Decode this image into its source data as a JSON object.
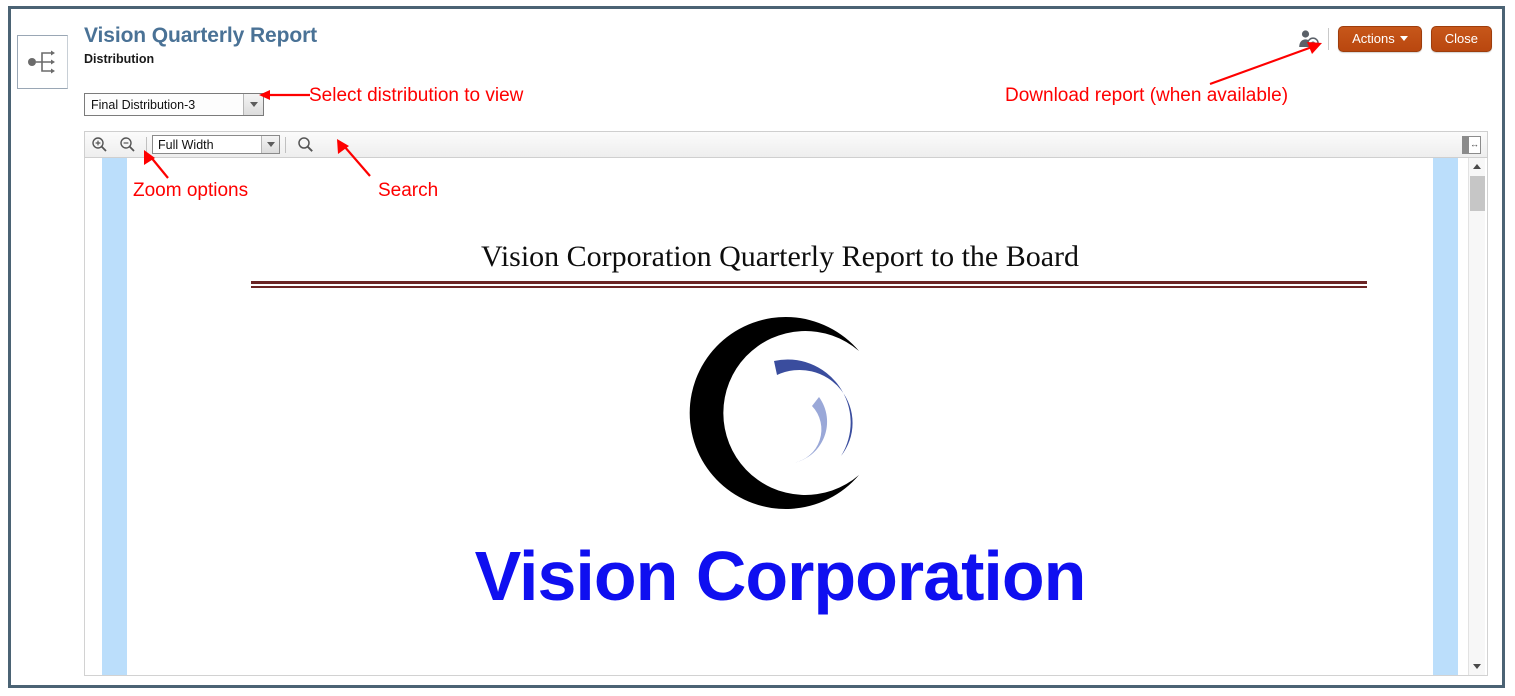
{
  "window": {
    "left_tab_icon": "workflow-branch-icon"
  },
  "header": {
    "title": "Vision Quarterly Report",
    "subtitle": "Distribution",
    "person_icon": "person-question-icon",
    "actions_label": "Actions",
    "close_label": "Close"
  },
  "distribution": {
    "selected": "Final Distribution-3",
    "dropdown_icon": "chevron-down-icon"
  },
  "pdf_toolbar": {
    "zoom_in_icon": "zoom-in-icon",
    "zoom_out_icon": "zoom-out-icon",
    "zoom_level": "Full Width",
    "zoom_dropdown_icon": "chevron-down-icon",
    "search_icon": "search-icon",
    "panel_toggle_icon": "side-panel-toggle-icon"
  },
  "document": {
    "title": "Vision Corporation Quarterly Report to the Board",
    "logo_icon": "vision-corporation-crescent-logo",
    "company_name": "Vision Corporation"
  },
  "scrollbar": {
    "up_icon": "scroll-up-arrow-icon",
    "down_icon": "scroll-down-arrow-icon"
  },
  "annotations": {
    "select_distribution": "Select distribution to view",
    "download_report": "Download report (when available)",
    "zoom_options": "Zoom options",
    "search": "Search"
  },
  "colors": {
    "accent_button": "#c15415",
    "header_title": "#4a7296",
    "annotation": "#fe0000",
    "company_blue": "#0f0ff0",
    "doc_rule": "#6b2424",
    "page_margin": "#bbdefb",
    "window_border": "#4b6374"
  }
}
